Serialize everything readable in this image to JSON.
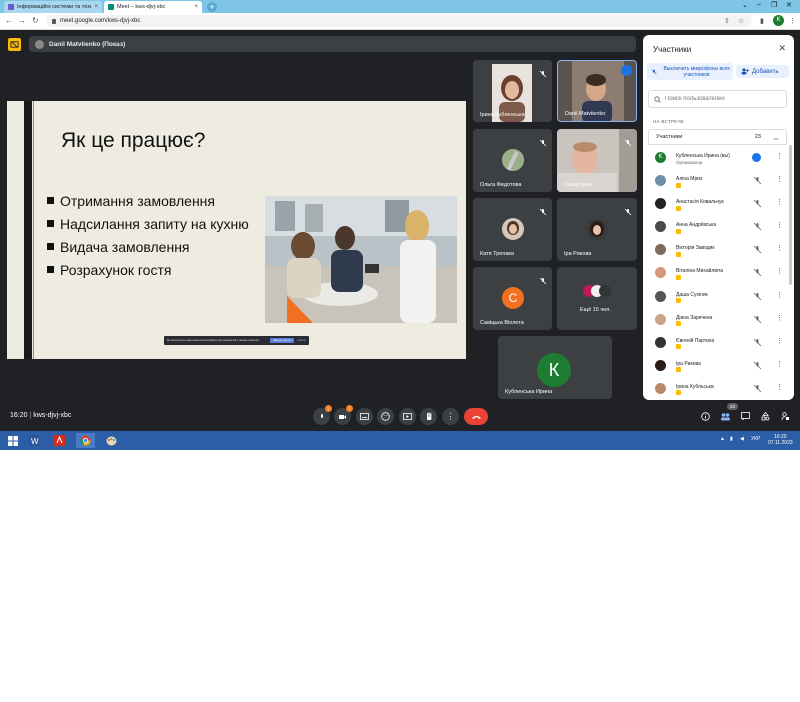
{
  "browser": {
    "tabs": [
      {
        "title": "Інформаційні системи та техно...",
        "active": false
      },
      {
        "title": "Meet – kws-djvj-xbc",
        "active": true
      }
    ],
    "url": "meet.google.com/kws-djvj-xbc",
    "profile_initial": "K"
  },
  "meet": {
    "presenter_label": "Danil Matviienko (Показ)",
    "meeting_time": "16:20",
    "meeting_code": "kws-djvj-xbc",
    "participant_count_badge": "23"
  },
  "slide": {
    "title": "Як це працює?",
    "bullets": [
      "Отримання замовлення",
      "Надсилання запиту на кухню",
      "Видача замовлення",
      "Розрахунок гостя"
    ],
    "notice_text": "Вы используете новую версию интерфейса для знакомства с нашим сервисом",
    "notice_btn": "Закрыть доступ",
    "notice_link": "Скрыть"
  },
  "tiles": [
    {
      "name": "Ірина Кубленська"
    },
    {
      "name": "Danil Matviienko"
    },
    {
      "name": "Ольга Федотова"
    },
    {
      "name": "Саша Ірчук"
    },
    {
      "name": "Катя Трепака"
    },
    {
      "name": "Іра Рикова"
    },
    {
      "name": "Савіцька Віолета",
      "initial": "С"
    },
    {
      "name": "Ещё 15 чел."
    },
    {
      "name": "Кубленська Ирина",
      "initial": "К"
    }
  ],
  "panel": {
    "title": "Участники",
    "mute_all": "Выключить микрофоны всех участников",
    "add": "Добавить",
    "search_placeholder": "Поиск пользователей",
    "section": "НА ВСТРЕЧЕ",
    "group_label": "Участники",
    "group_count": "23",
    "participants": [
      {
        "name": "Кубленська Ирина (вы)",
        "sub": "Организатор"
      },
      {
        "name": "Аліна Мрих"
      },
      {
        "name": "Анастасія Ковальчук"
      },
      {
        "name": "Анна Андріївська"
      },
      {
        "name": "Вікторія Заводяк"
      },
      {
        "name": "Віталіна Михайлівта"
      },
      {
        "name": "Даша Сухіняк"
      },
      {
        "name": "Діана Заречена"
      },
      {
        "name": "Євгеній Партиха"
      },
      {
        "name": "Іра Рикова"
      },
      {
        "name": "Ірина Кубльська"
      }
    ]
  },
  "taskbar": {
    "lang": "УКР",
    "clock_time": "16:20",
    "clock_date": "07.11.2023"
  },
  "colors": {
    "meet_bg": "#202124",
    "tile_bg": "#3c4043",
    "hangup": "#ea4335",
    "accent_blue": "#1a73e8",
    "avatar_green": "#1e7d32",
    "avatar_orange": "#f36f21"
  }
}
